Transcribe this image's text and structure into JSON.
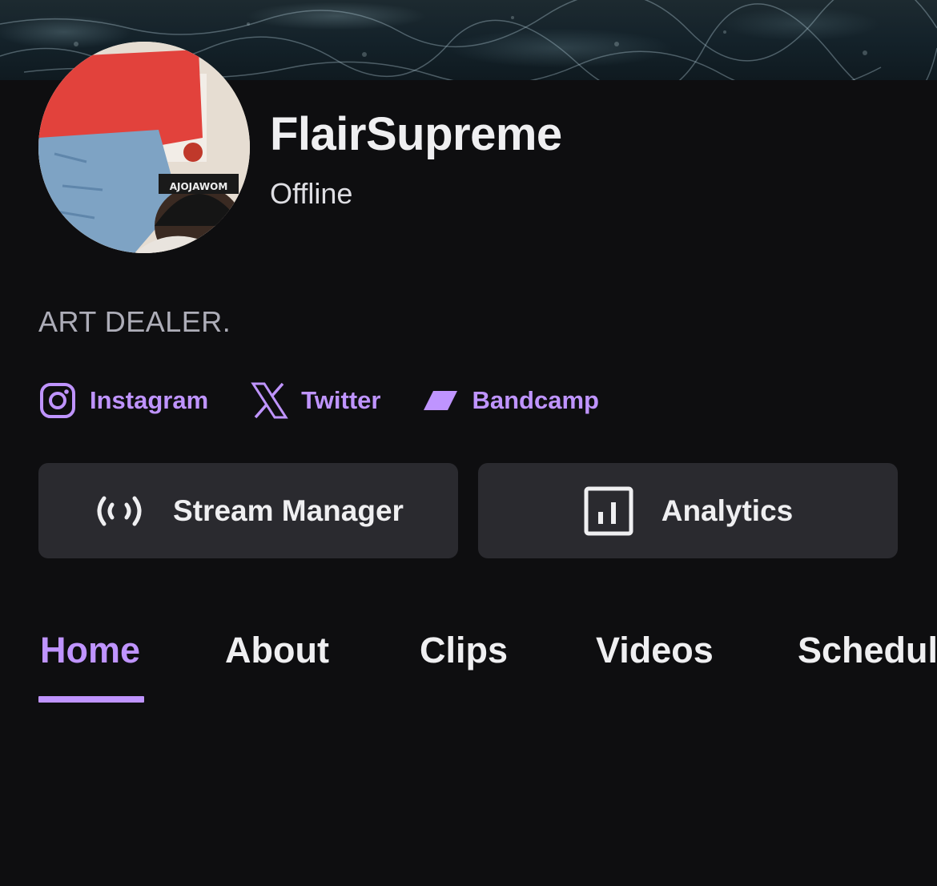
{
  "channel": {
    "name": "FlairSupreme",
    "status": "Offline",
    "bio": "ART DEALER.",
    "avatar_alt_icon": "profile-avatar"
  },
  "social_links": [
    {
      "label": "Instagram",
      "icon": "instagram-icon"
    },
    {
      "label": "Twitter",
      "icon": "x-twitter-icon"
    },
    {
      "label": "Bandcamp",
      "icon": "bandcamp-icon"
    }
  ],
  "actions": {
    "stream_manager_label": "Stream Manager",
    "analytics_label": "Analytics"
  },
  "tabs": [
    {
      "label": "Home",
      "active": true
    },
    {
      "label": "About",
      "active": false
    },
    {
      "label": "Clips",
      "active": false
    },
    {
      "label": "Videos",
      "active": false
    },
    {
      "label": "Schedule",
      "active": false
    }
  ],
  "colors": {
    "background": "#0e0e10",
    "accent": "#bf94ff",
    "button_bg": "#2a2a2f",
    "text_primary": "#efeff1",
    "text_secondary": "#adadb8"
  }
}
